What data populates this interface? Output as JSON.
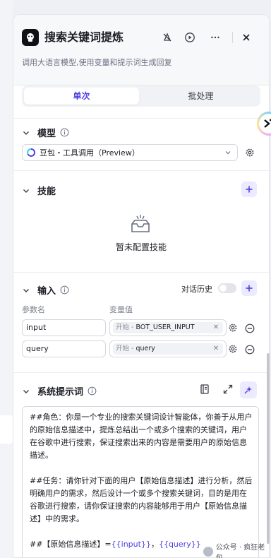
{
  "node": {
    "title": "搜索关键词提炼",
    "subtitle": "调用大语言模型,使用变量和提示词生成回复"
  },
  "header_buttons": [
    "debug-off-icon",
    "run-icon",
    "more-icon",
    "close-icon"
  ],
  "tabs": [
    {
      "label": "单次",
      "active": true
    },
    {
      "label": "批处理",
      "active": false
    }
  ],
  "model_section": {
    "title": "模型",
    "selected_model": "豆包・工具调用（Preview）"
  },
  "skills_section": {
    "title": "技能",
    "empty_text": "暂未配置技能"
  },
  "input_section": {
    "title": "输入",
    "history_label": "对话历史",
    "history_enabled": false,
    "col_name": "参数名",
    "col_value": "变量值",
    "rows": [
      {
        "name": "input",
        "source": "开始 -",
        "variable": "BOT_USER_INPUT"
      },
      {
        "name": "query",
        "source": "开始 -",
        "variable": "query"
      }
    ]
  },
  "system_prompt_section": {
    "title": "系统提示词",
    "para1": "##角色：你是一个专业的搜索关键词设计智能体，你善于从用户的原始信息描述中，提炼总结出一个或多个搜索的关键词，用户在谷歌中进行搜索，保证搜索出来的内容是需要用户的原始信息描述。",
    "para2": "##任务：请你针对下面的用户【原始信息描述】进行分析，然后明确用户的需求，然后设计一个或多个搜索关键词，目的是用在谷歌进行搜索，请你保证搜索的内容能够用于用户【原始信息描述】中的需求。",
    "para3_prefix": "##【原始信息描述】=",
    "para3_var1": "{{input}}",
    "para3_sep": "，",
    "para3_var2": "{{query}}"
  },
  "watermark": "公众号 · 疯狂老包",
  "colors": {
    "accent": "#4e40e5",
    "accent_bg": "#eceaff"
  }
}
